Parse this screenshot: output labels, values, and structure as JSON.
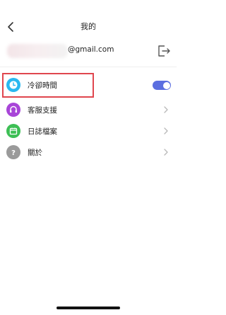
{
  "header": {
    "title": "我的",
    "back_icon": "chevron-left-icon"
  },
  "account": {
    "email": "@gmail.com",
    "logout_icon": "logout-icon"
  },
  "settings": {
    "items": [
      {
        "label": "冷卻時間",
        "icon": "clock-icon",
        "icon_color": "#2ab8f0",
        "control": "toggle",
        "toggle_on": true
      },
      {
        "label": "客服支援",
        "icon": "headset-icon",
        "icon_color": "#a845d8",
        "control": "chevron"
      },
      {
        "label": "日誌檔案",
        "icon": "calendar-icon",
        "icon_color": "#3dbf55",
        "control": "chevron"
      },
      {
        "label": "關於",
        "icon": "question-icon",
        "icon_color": "#9a9a9a",
        "control": "chevron"
      }
    ]
  },
  "colors": {
    "toggle_on": "#5b6ee0",
    "highlight_border": "#e0464e"
  }
}
